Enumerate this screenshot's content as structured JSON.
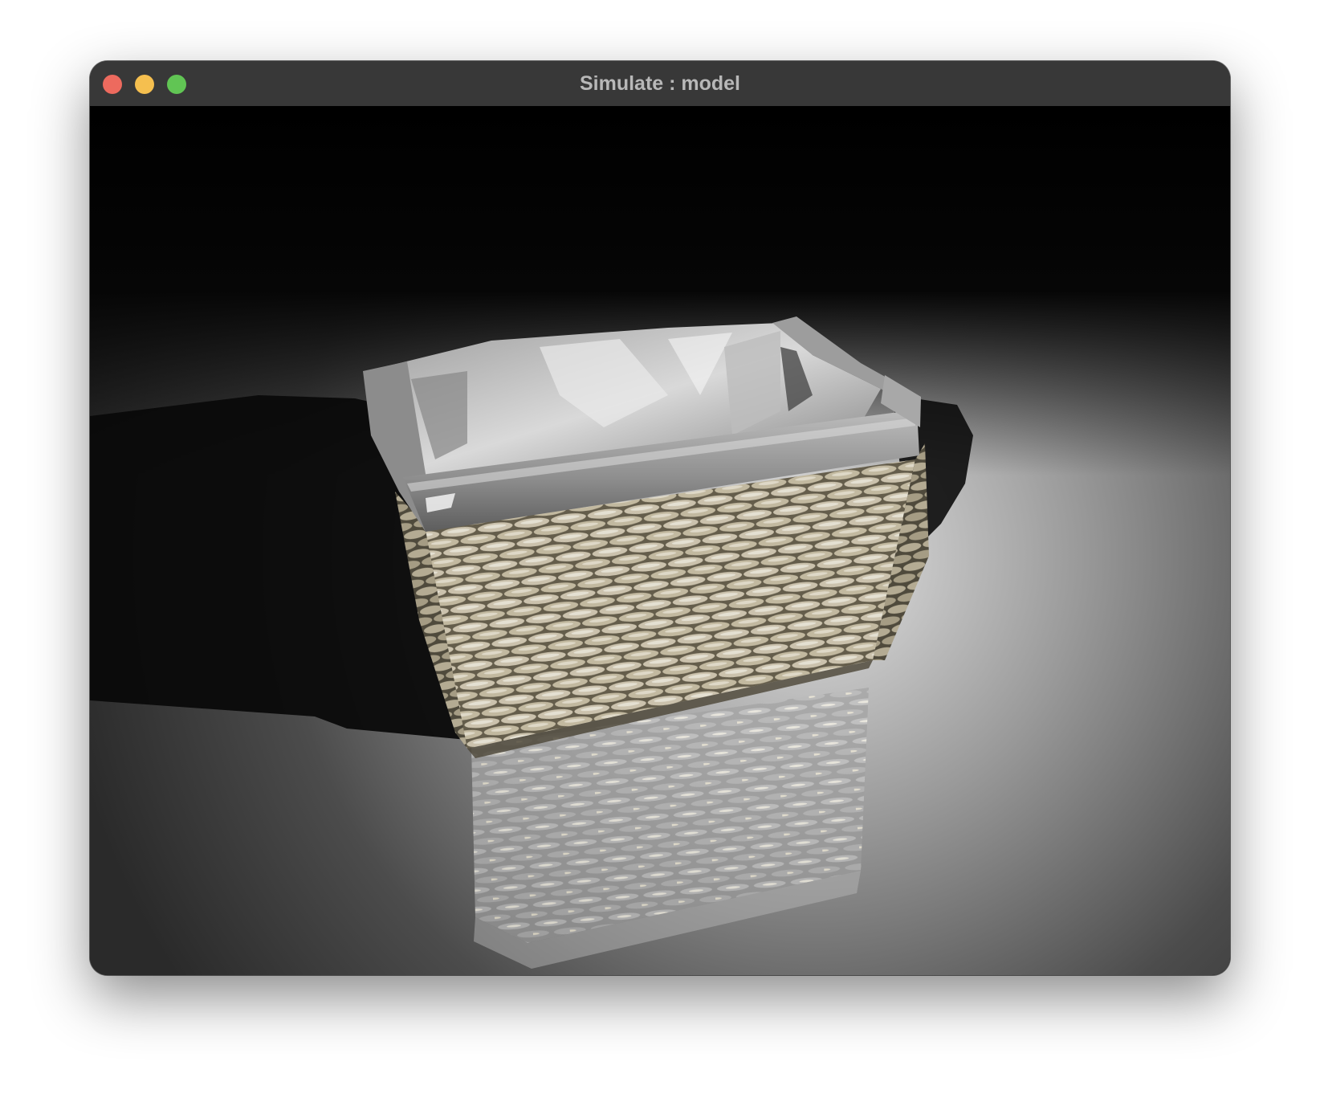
{
  "window": {
    "title": "Simulate : model",
    "controls": {
      "close": "close-button",
      "minimize": "minimize-button",
      "maximize": "maximize-button"
    }
  },
  "scene": {
    "object": "woven basket with grey liner",
    "background": "dark gradient with reflective floor"
  },
  "colors": {
    "titlebar": "#383838",
    "title_text": "#b8b8b8",
    "close": "#ed6a5e",
    "minimize": "#f5bf4f",
    "maximize": "#61c554"
  }
}
